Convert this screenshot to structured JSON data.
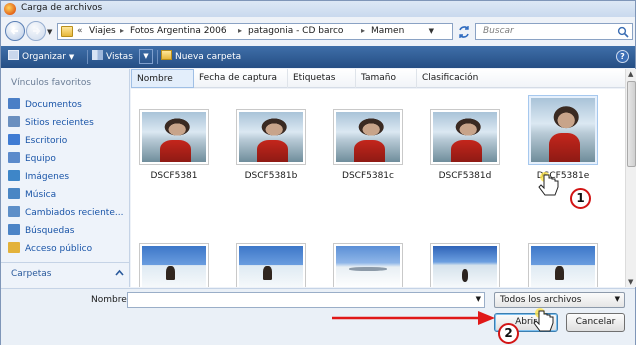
{
  "window": {
    "title": "Carga de archivos"
  },
  "address": {
    "prefix": "«",
    "crumbs": [
      "Viajes",
      "Fotos Argentina 2006",
      "patagonia - CD barco",
      "Mamen"
    ],
    "separator": "▸"
  },
  "search": {
    "placeholder": "Buscar"
  },
  "toolbar": {
    "organize_label": "Organizar",
    "views_label": "Vistas",
    "new_folder_label": "Nueva carpeta",
    "help_label": "?"
  },
  "sidebar": {
    "favorites_heading": "Vínculos favoritos",
    "items": [
      {
        "label": "Documentos",
        "icon": "documents-icon",
        "color": "#4b7fc6"
      },
      {
        "label": "Sitios recientes",
        "icon": "recent-places-icon",
        "color": "#6a8fbf"
      },
      {
        "label": "Escritorio",
        "icon": "desktop-icon",
        "color": "#3f7bd3"
      },
      {
        "label": "Equipo",
        "icon": "computer-icon",
        "color": "#5b8acb"
      },
      {
        "label": "Imágenes",
        "icon": "pictures-icon",
        "color": "#3e86c8"
      },
      {
        "label": "Música",
        "icon": "music-icon",
        "color": "#4a86c4"
      },
      {
        "label": "Cambiados reciente...",
        "icon": "recently-changed-icon",
        "color": "#5e8fc8"
      },
      {
        "label": "Búsquedas",
        "icon": "searches-icon",
        "color": "#4c84c6"
      },
      {
        "label": "Acceso público",
        "icon": "public-folder-icon",
        "color": "#e3b23b"
      }
    ],
    "folders_label": "Carpetas"
  },
  "columns": [
    "Nombre",
    "Fecha de captura",
    "Etiquetas",
    "Tamaño",
    "Clasificación"
  ],
  "files": [
    {
      "name": "DSCF5381",
      "kind": "portrait"
    },
    {
      "name": "DSCF5381b",
      "kind": "portrait"
    },
    {
      "name": "DSCF5381c",
      "kind": "portrait"
    },
    {
      "name": "DSCF5381d",
      "kind": "portrait"
    },
    {
      "name": "DSCF5381e",
      "kind": "portrait"
    },
    {
      "name": "",
      "kind": "snow-person"
    },
    {
      "name": "",
      "kind": "snow-person"
    },
    {
      "name": "",
      "kind": "snow-plain"
    },
    {
      "name": "",
      "kind": "snow-person"
    },
    {
      "name": "",
      "kind": "snow-person"
    }
  ],
  "bottom": {
    "filename_label": "Nombre:",
    "filename_value": "",
    "filetype_value": "Todos los archivos",
    "open_label": "Abrir",
    "cancel_label": "Cancelar"
  },
  "annotations": {
    "step1": "1",
    "step2": "2",
    "arrow_color": "#e01818"
  }
}
